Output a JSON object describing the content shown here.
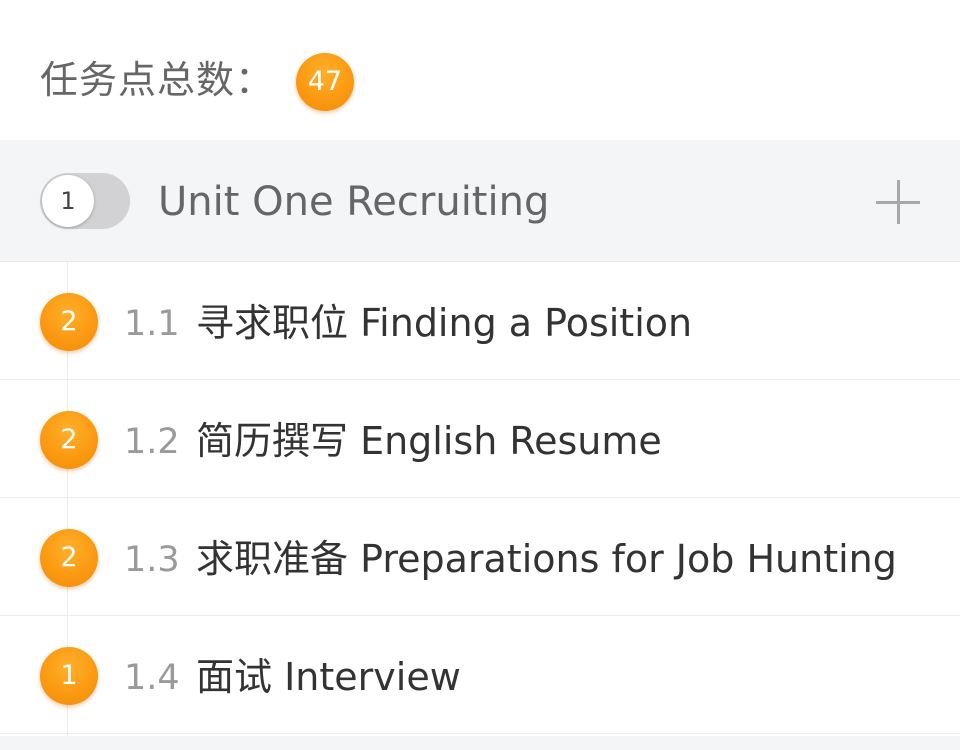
{
  "total": {
    "label": "任务点总数：",
    "count": "47"
  },
  "unit": {
    "toggle_number": "1",
    "title": "Unit One Recruiting",
    "add_icon": "plus-icon"
  },
  "lessons": [
    {
      "badge": "2",
      "number": "1.1",
      "title": "寻求职位 Finding a Position"
    },
    {
      "badge": "2",
      "number": "1.2",
      "title": "简历撰写 English Resume"
    },
    {
      "badge": "2",
      "number": "1.3",
      "title": "求职准备 Preparations for Job Hunting"
    },
    {
      "badge": "1",
      "number": "1.4",
      "title": "面试 Interview"
    }
  ],
  "colors": {
    "badge_orange": "#fb9a12",
    "header_bg": "#f4f5f7",
    "muted_text": "#9a9a9a"
  }
}
